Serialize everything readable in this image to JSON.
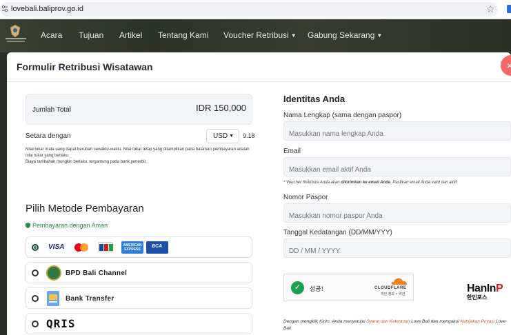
{
  "browser": {
    "url": "lovebali.baliprov.go.id"
  },
  "nav": {
    "items": [
      {
        "label": "Acara"
      },
      {
        "label": "Tujuan"
      },
      {
        "label": "Artikel"
      },
      {
        "label": "Tentang Kami"
      },
      {
        "label": "Voucher Retribusi"
      },
      {
        "label": "Gabung Sekarang"
      }
    ]
  },
  "modal": {
    "title": "Formulir Retribusi Wisatawan",
    "close_label": "×"
  },
  "payment_summary": {
    "total_label": "Jumlah Total",
    "total_amount": "IDR 150,000",
    "equivalent_label": "Setara dengan",
    "currency": "USD",
    "equivalent_value": "9.18",
    "note_lines": [
      "Nilai tukar mata uang dapat berubah sewaktu-waktu. Nilai tukar tetap yang ditampilkan pada halaman pembayaran adalah nilai tukar yang berlaku.",
      "Biaya tambahan mungkin berlaku, tergantung pada bank penerbit."
    ]
  },
  "payment_methods": {
    "title": "Pilih Metode Pembayaran",
    "secure_label": "Pembayaran dengan Aman",
    "options": [
      {
        "label": "",
        "selected": true,
        "brands": [
          "VISA",
          "AMERICAN EXPRESS",
          "BCA"
        ]
      },
      {
        "label": "BPD Bali Channel",
        "selected": false
      },
      {
        "label": "Bank Transfer",
        "selected": false
      },
      {
        "label": "QRIS",
        "selected": false
      }
    ]
  },
  "identity": {
    "title": "Identitas Anda",
    "full_name": {
      "label": "Nama Lengkap (sama dengan paspor)",
      "placeholder": "Masukkan nama lengkap Anda"
    },
    "email": {
      "label": "Email",
      "placeholder": "Masukkan email aktif Anda"
    },
    "email_note_pre": "* Voucher Retribusi Anda akan ",
    "email_note_bold": "dikirimkan ke email Anda",
    "email_note_post": ". Pastikan email Anda valid dan aktif.",
    "passport": {
      "label": "Nomor Paspor",
      "placeholder": "Masukkan nomor paspor Anda"
    },
    "arrival_date": {
      "label": "Tanggal Kedatangan (DD/MM/YYY)",
      "placeholder": "DD / MM / YYYY"
    }
  },
  "captcha": {
    "status": "성공!",
    "provider": "CLOUDFLARE",
    "links": "개인 정보 • 약관"
  },
  "watermark": {
    "big_black": "HanIn",
    "big_red": "P",
    "small": "한인포스"
  },
  "terms": {
    "pre": "Dengan mengklik Kirim, Anda menyetujui ",
    "link1": "Syarat dan Ketentuan",
    "mid": " Love Bali dan mengakui ",
    "link2": "Kebijakan Privasi",
    "post": " Love Bali"
  },
  "colors": {
    "secure_green": "#2f8a4c",
    "close_red": "#f26b6b",
    "link_orange": "#d35a2a"
  }
}
